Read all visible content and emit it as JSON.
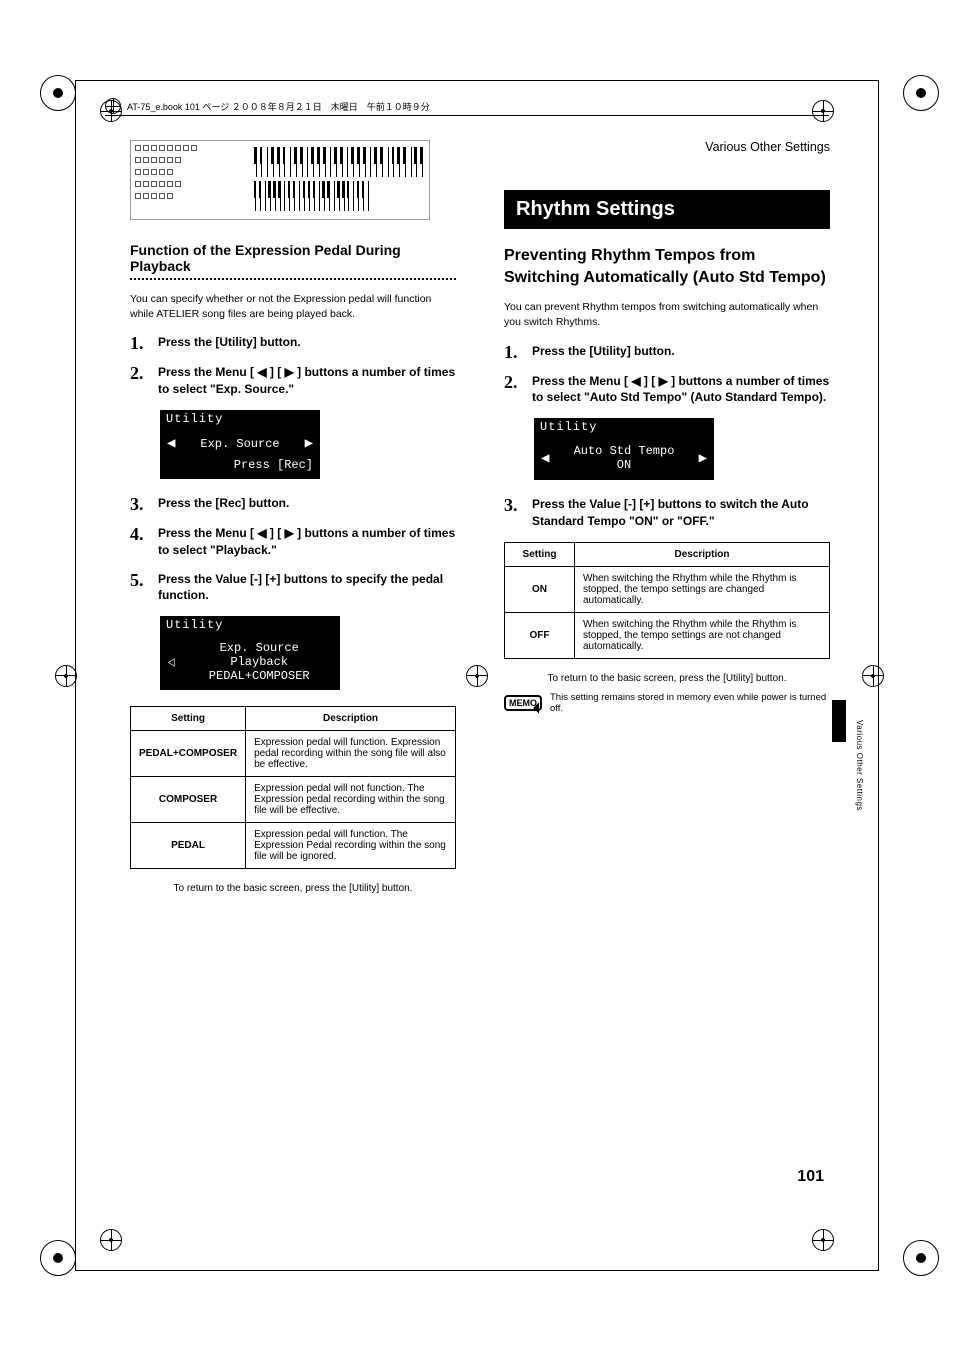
{
  "header_meta": "AT-75_e.book  101 ページ  ２００８年８月２１日　木曜日　午前１０時９分",
  "breadcrumb": "Various Other Settings",
  "side_label": "Various Other Settings",
  "page_number": "101",
  "left": {
    "heading": "Function of the Expression Pedal During Playback",
    "intro": "You can specify whether or not the Expression pedal will function while ATELIER song files are being played back.",
    "steps": [
      "Press the [Utility] button.",
      "Press the Menu [ ◀ ] [ ▶ ] buttons a number of times to select \"Exp. Source.\"",
      "Press the [Rec] button.",
      "Press the Menu [ ◀ ] [ ▶ ] buttons a number of times to select \"Playback.\"",
      "Press the Value [-] [+] buttons to specify the pedal function."
    ],
    "lcd1": {
      "title": "Utility",
      "line1": "Exp. Source",
      "line2": "Press [Rec]"
    },
    "lcd2": {
      "title": "Utility",
      "line1": "Exp. Source",
      "line2": "Playback",
      "line3": "PEDAL+COMPOSER"
    },
    "table": {
      "headers": [
        "Setting",
        "Description"
      ],
      "rows": [
        {
          "setting": "PEDAL+COMPOSER",
          "desc": "Expression pedal will function. Expression pedal recording within the song file will also be effective."
        },
        {
          "setting": "COMPOSER",
          "desc": "Expression pedal will not function. The Expression pedal recording within the song file will be effective."
        },
        {
          "setting": "PEDAL",
          "desc": "Expression pedal will function. The Expression Pedal recording within the song file will be ignored."
        }
      ]
    },
    "footnote": "To return to the basic screen, press the [Utility] button."
  },
  "right": {
    "bar_title": "Rhythm Settings",
    "sub_heading": "Preventing Rhythm Tempos from Switching Automatically (Auto Std Tempo)",
    "intro": "You can prevent Rhythm tempos from switching automatically when you switch Rhythms.",
    "steps": [
      "Press the [Utility] button.",
      "Press the Menu [ ◀ ] [ ▶ ] buttons a number of times to select \"Auto Std Tempo\" (Auto Standard Tempo).",
      "Press the Value [-] [+] buttons to switch the Auto Standard Tempo \"ON\" or \"OFF.\""
    ],
    "lcd": {
      "title": "Utility",
      "line1": "Auto Std Tempo",
      "line2": "ON"
    },
    "table": {
      "headers": [
        "Setting",
        "Description"
      ],
      "rows": [
        {
          "setting": "ON",
          "desc": "When switching the Rhythm while the Rhythm is stopped, the tempo settings are changed automatically."
        },
        {
          "setting": "OFF",
          "desc": "When switching the Rhythm while the Rhythm is stopped, the tempo settings are not changed automatically."
        }
      ]
    },
    "footnote": "To return to the basic screen, press the [Utility] button.",
    "memo_label": "MEMO",
    "memo_text": "This setting remains stored in memory even while power is turned off."
  }
}
